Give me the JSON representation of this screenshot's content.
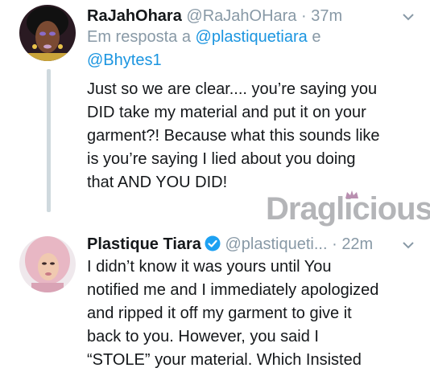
{
  "tweets": [
    {
      "display_name": "RaJahOhara",
      "handle": "@RaJahOHara",
      "separator": "·",
      "time": "37m",
      "reply_prefix": "Em resposta a",
      "reply_to_1": "@plastiquetiara",
      "reply_join": "e",
      "reply_to_2": "@Bhytes1",
      "text_lines": [
        "Just so we are clear.... you’re saying you",
        "DID take my material and put it on your",
        "garment?!  Because what this sounds like",
        "is you’re saying I lied about you doing",
        "that AND YOU DID!"
      ]
    },
    {
      "display_name": "Plastique Tiara",
      "verified": true,
      "handle": "@plastiqueti...",
      "separator": "·",
      "time": "22m",
      "text_lines": [
        "I didn’t know it was yours until You",
        "notified me and I immediately apologized",
        "and ripped it off my garment to give it",
        "back to you. However, you said I",
        "“STOLE” your material. Which Insisted"
      ]
    }
  ],
  "watermark": "Draglicious",
  "colors": {
    "link": "#1b95e0",
    "muted": "#8899a6",
    "text": "#14171a",
    "thread_line": "#cfd9de",
    "verified": "#1da1f2"
  },
  "icons": [
    "chevron-down-icon",
    "verified-badge-icon"
  ]
}
